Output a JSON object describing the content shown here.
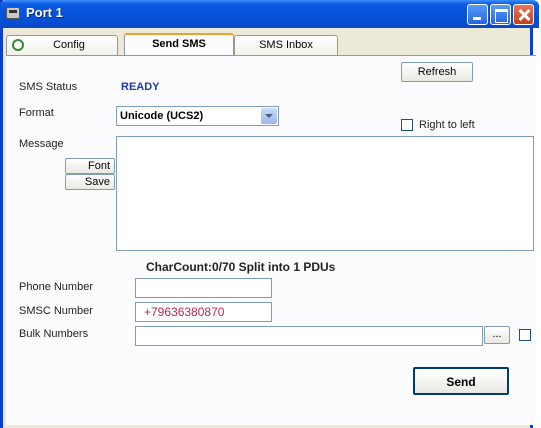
{
  "window": {
    "title": "Port 1"
  },
  "tabs": [
    {
      "label": "Config"
    },
    {
      "label": "Send SMS"
    },
    {
      "label": "SMS Inbox"
    }
  ],
  "sms_status": {
    "label": "SMS Status",
    "value": "READY"
  },
  "refresh_label": "Refresh",
  "format": {
    "label": "Format",
    "selected": "Unicode (UCS2)"
  },
  "right_to_left": {
    "label": "Right to left",
    "checked": false
  },
  "message": {
    "label": "Message",
    "value": ""
  },
  "font_label": "Font",
  "save_label": "Save",
  "charcount": "CharCount:0/70  Split into 1 PDUs",
  "phone_number": {
    "label": "Phone Number",
    "value": ""
  },
  "smsc_number": {
    "label": "SMSC Number",
    "value": "+79636380870"
  },
  "bulk_numbers": {
    "label": "Bulk Numbers",
    "value": "",
    "browse_label": "...",
    "checked": false
  },
  "send_label": "Send",
  "colors": {
    "title_bar": "#0452d8",
    "status_value": "#1a3ca8",
    "smsc_value": "#c0264a"
  }
}
